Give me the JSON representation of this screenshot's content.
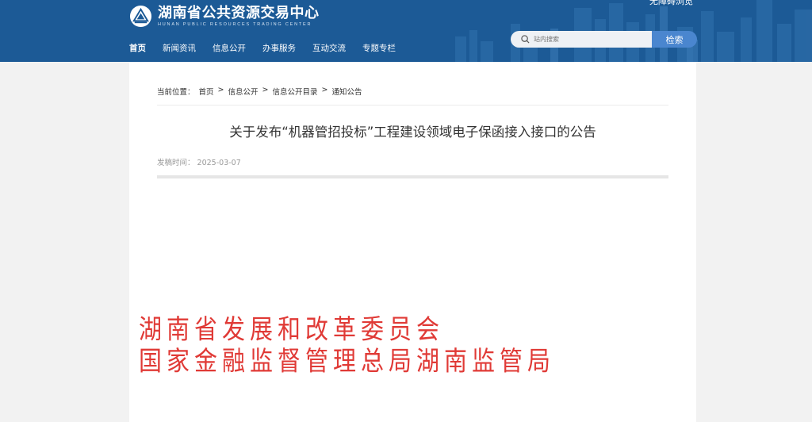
{
  "header": {
    "logo_cn": "湖南省公共资源交易中心",
    "logo_en": "HUNAN PUBLIC RESOURCES TRADING CENTER",
    "top_right_text": "无障碍浏览",
    "colors": {
      "header_bg": "#1c5a96",
      "search_btn": "#4a86cf"
    }
  },
  "nav": {
    "items": [
      {
        "label": "首页"
      },
      {
        "label": "新闻资讯"
      },
      {
        "label": "信息公开"
      },
      {
        "label": "办事服务"
      },
      {
        "label": "互动交流"
      },
      {
        "label": "专题专栏"
      }
    ]
  },
  "search": {
    "placeholder": "站内搜索",
    "button_label": "检索"
  },
  "breadcrumb": {
    "prefix": "当前位置：",
    "items": [
      "首页",
      "信息公开",
      "信息公开目录",
      "通知公告"
    ],
    "separator": ">"
  },
  "article": {
    "title": "关于发布“机器管招投标”工程建设领域电子保函接入接口的公告",
    "date_label": "发稿时间：",
    "date": "2025-03-07"
  },
  "document_image": {
    "lines": [
      "湖南省发展和改革委员会",
      "国家金融监督管理总局湖南监管局"
    ],
    "color": "#e03a36"
  }
}
